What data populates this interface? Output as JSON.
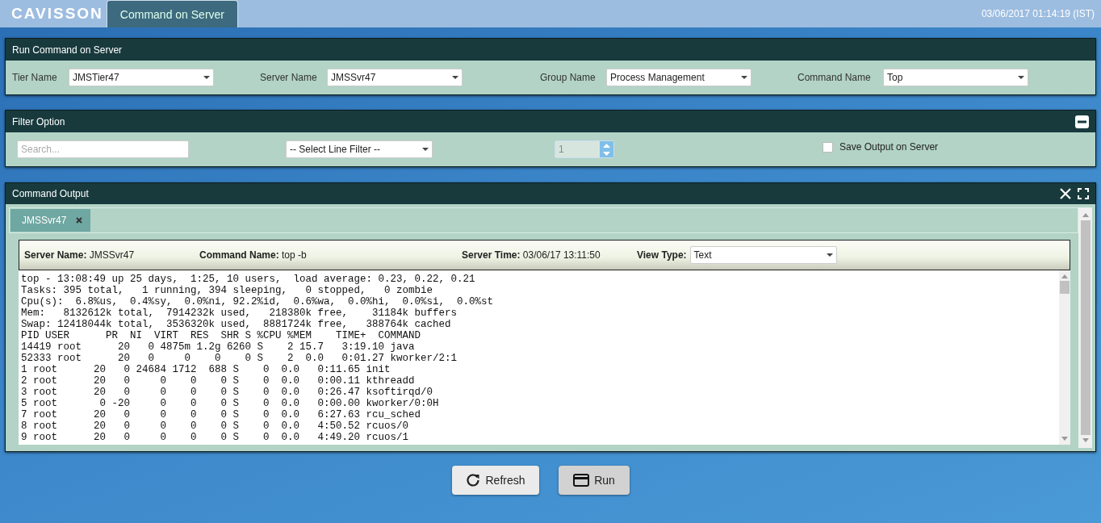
{
  "header": {
    "logo": "CAVISSON",
    "tabs": [
      {
        "label": "Command on Server",
        "selected": true
      }
    ],
    "datetime": "03/06/2017 01:14:19 (IST)"
  },
  "run_panel": {
    "title": "Run Command on Server",
    "fields": [
      {
        "label": "Tier Name",
        "value": "JMSTier47"
      },
      {
        "label": "Server Name",
        "value": "JMSSvr47"
      },
      {
        "label": "Group Name",
        "value": "Process Management"
      },
      {
        "label": "Command Name",
        "value": "Top"
      }
    ]
  },
  "filter_panel": {
    "title": "Filter Option",
    "search": {
      "placeholder": "Search..."
    },
    "line_filter": "-- Select Line Filter --",
    "count": {
      "value": "1",
      "disabled": true
    },
    "save_output": {
      "label": "Save Output on Server",
      "checked": false
    }
  },
  "output_panel": {
    "title": "Command Output",
    "tabs": [
      {
        "label": "JMSSvr47",
        "selected": true
      }
    ],
    "info": [
      {
        "label": "Server Name:",
        "value": "JMSSvr47"
      },
      {
        "label": "Command Name:",
        "value": "top -b"
      },
      {
        "label": "Server Time:",
        "value": "03/06/17 13:11:50"
      }
    ],
    "view_type": {
      "label": "View Type:",
      "value": "Text"
    },
    "lines": [
      "top - 13:08:49 up 25 days,  1:25, 10 users,  load average: 0.23, 0.22, 0.21",
      "Tasks: 395 total,   1 running, 394 sleeping,   0 stopped,   0 zombie",
      "Cpu(s):  6.8%us,  0.4%sy,  0.0%ni, 92.2%id,  0.6%wa,  0.0%hi,  0.0%si,  0.0%st",
      "Mem:   8132612k total,  7914232k used,   218380k free,    31184k buffers",
      "Swap: 12418044k total,  3536320k used,  8881724k free,   388764k cached",
      "PID USER      PR  NI  VIRT  RES  SHR S %CPU %MEM    TIME+  COMMAND",
      "14419 root      20   0 4875m 1.2g 6260 S    2 15.7   3:19.10 java",
      "52333 root      20   0     0    0    0 S    2  0.0   0:01.27 kworker/2:1",
      "1 root      20   0 24684 1712  688 S    0  0.0   0:11.65 init",
      "2 root      20   0     0    0    0 S    0  0.0   0:00.11 kthreadd",
      "3 root      20   0     0    0    0 S    0  0.0   0:26.47 ksoftirqd/0",
      "5 root       0 -20     0    0    0 S    0  0.0   0:00.00 kworker/0:0H",
      "7 root      20   0     0    0    0 S    0  0.0   6:27.63 rcu_sched",
      "8 root      20   0     0    0    0 S    0  0.0   4:50.52 rcuos/0",
      "9 root      20   0     0    0    0 S    0  0.0   4:49.20 rcuos/1"
    ]
  },
  "buttons": [
    {
      "label": "Refresh",
      "kind": "refresh"
    },
    {
      "label": "Run",
      "kind": "run"
    }
  ]
}
